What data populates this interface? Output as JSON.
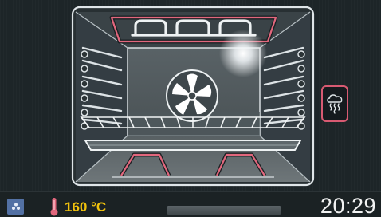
{
  "cavity": {
    "fan_icon": "fan-icon",
    "top_element_icon": "top-heating-element",
    "bottom_element_icon": "bottom-heating-element",
    "light_icon": "oven-light",
    "rack_icon": "wire-rack"
  },
  "mode_button": {
    "icon": "steam-cloud-icon"
  },
  "status_bar": {
    "tray_icon": "steam-tray-icon",
    "thermometer_icon": "thermometer-icon",
    "temperature": "160 °C",
    "progress": 0.0,
    "clock": "20:29"
  },
  "colors": {
    "heating_element": "#e2677d",
    "temperature_text": "#f1c20d",
    "tray_button": "#5371a4",
    "outline": "#e8ecee"
  }
}
